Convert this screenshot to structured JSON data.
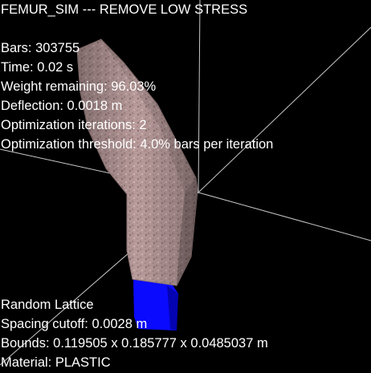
{
  "window": {
    "title": "FEMUR_SIM --- REMOVE LOW STRESS"
  },
  "stats": {
    "bars_label": "Bars: ",
    "bars_value": "303755",
    "time_label": "Time: ",
    "time_value": "0.02 s",
    "weight_label": "Weight remaining: ",
    "weight_value": "96.03%",
    "deflection_label": "Deflection: ",
    "deflection_value": "0.0018 m",
    "iterations_label": "Optimization iterations: ",
    "iterations_value": "2",
    "threshold_label": "Optimization threshold: ",
    "threshold_value": "4.0% bars per iteration"
  },
  "lattice": {
    "type": "Random Lattice",
    "spacing_label": "Spacing cutoff: ",
    "spacing_value": "0.0028 m",
    "bounds_label": "Bounds: ",
    "bounds_value": "0.119505 x 0.185777 x 0.0485037 m",
    "material_label": "Material: ",
    "material_value": "PLASTIC"
  },
  "colors": {
    "background": "#000000",
    "text": "#ffffff",
    "bone": "#bfa0a0",
    "bone_shadow": "#8f7676",
    "support": "#1010ff",
    "axis": "#c8c8c8"
  },
  "icons": {
    "axes": "axis-lines",
    "model": "femur-lattice-mesh",
    "fixture": "blue-support-block"
  }
}
